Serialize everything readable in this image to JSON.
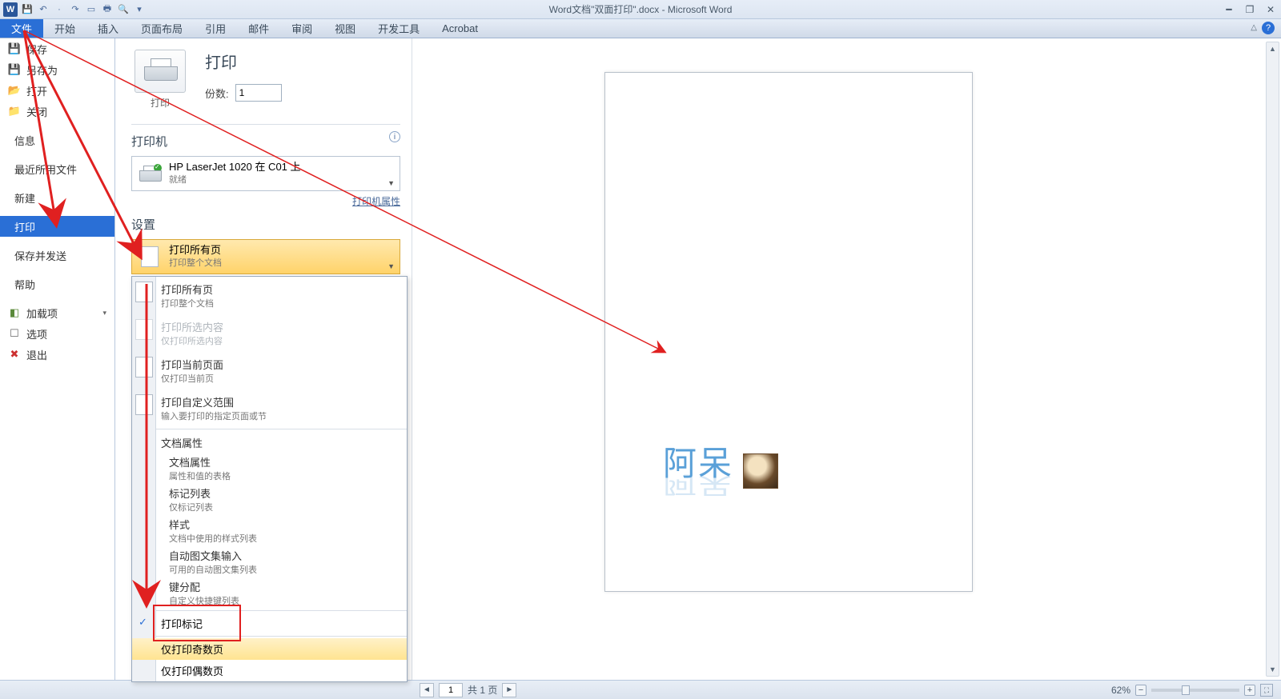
{
  "titlebar": {
    "title": "Word文档\"双面打印\".docx - Microsoft Word",
    "logo": "W"
  },
  "ribbon": {
    "tabs": [
      "文件",
      "开始",
      "插入",
      "页面布局",
      "引用",
      "邮件",
      "审阅",
      "视图",
      "开发工具",
      "Acrobat"
    ],
    "active": "文件"
  },
  "sidebar": {
    "save": "保存",
    "saveas": "另存为",
    "open": "打开",
    "close": "关闭",
    "info": "信息",
    "recent": "最近所用文件",
    "new": "新建",
    "print": "打印",
    "saveandsend": "保存并发送",
    "help": "帮助",
    "addins": "加载项",
    "options": "选项",
    "exit": "退出"
  },
  "print": {
    "header": "打印",
    "button_label": "打印",
    "copies_label": "份数:",
    "copies_value": "1",
    "printer_section": "打印机",
    "printer_name": "HP LaserJet 1020 在 C01 上",
    "printer_status": "就绪",
    "printer_props": "打印机属性",
    "settings_section": "设置",
    "range_label": "打印所有页",
    "range_sub": "打印整个文档"
  },
  "range_menu": {
    "opt1_t": "打印所有页",
    "opt1_s": "打印整个文档",
    "opt2_t": "打印所选内容",
    "opt2_s": "仅打印所选内容",
    "opt3_t": "打印当前页面",
    "opt3_s": "仅打印当前页",
    "opt4_t": "打印自定义范围",
    "opt4_s": "输入要打印的指定页面或节",
    "docprops_header": "文档属性",
    "dp1": "文档属性",
    "dp1s": "属性和值的表格",
    "dp2": "标记列表",
    "dp2s": "仅标记列表",
    "dp3": "样式",
    "dp3s": "文档中使用的样式列表",
    "dp4": "自动图文集输入",
    "dp4s": "可用的自动图文集列表",
    "dp5": "键分配",
    "dp5s": "自定义快捷键列表",
    "printmarks": "打印标记",
    "odd": "仅打印奇数页",
    "even": "仅打印偶数页"
  },
  "preview": {
    "watermark": "阿呆"
  },
  "pagenav": {
    "page": "1",
    "total": "共 1 页"
  },
  "zoom": {
    "value": "62%"
  }
}
